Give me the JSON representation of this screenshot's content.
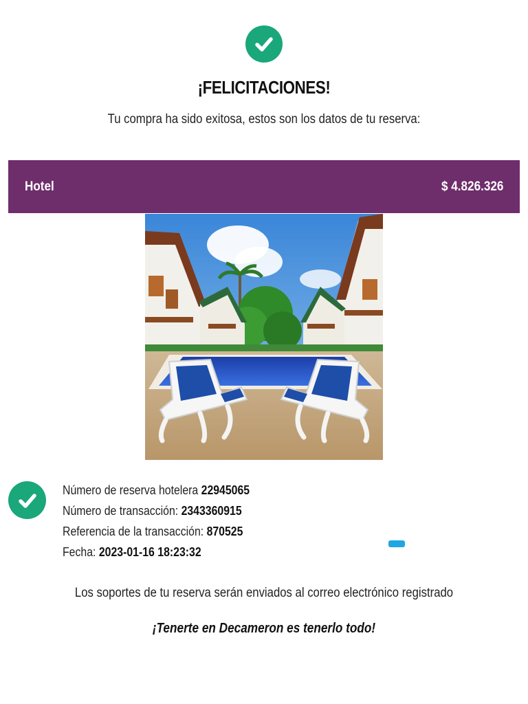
{
  "header": {
    "title": "¡FELICITACIONES!",
    "subtitle": "Tu compra ha sido exitosa, estos son los datos de tu reserva:"
  },
  "product": {
    "label": "Hotel",
    "price": "$ 4.826.326",
    "bar_color": "#6e2d6b"
  },
  "details": {
    "rows": [
      {
        "label": "Número de reserva hotelera ",
        "value": "22945065"
      },
      {
        "label": "Número de transacción: ",
        "value": "2343360915"
      },
      {
        "label": "Referencia de la transacción: ",
        "value": "870525"
      },
      {
        "label": "Fecha: ",
        "value": "2023-01-16 18:23:32"
      }
    ]
  },
  "footer": {
    "support_text": "Los soportes de tu reserva serán enviados al correo electrónico registrado",
    "slogan": "¡Tenerte en Decameron es tenerlo todo!"
  },
  "icons": {
    "top": "check-circle-icon",
    "details": "check-circle-icon"
  },
  "colors": {
    "success": "#1aa77a",
    "accent": "#6e2d6b"
  }
}
